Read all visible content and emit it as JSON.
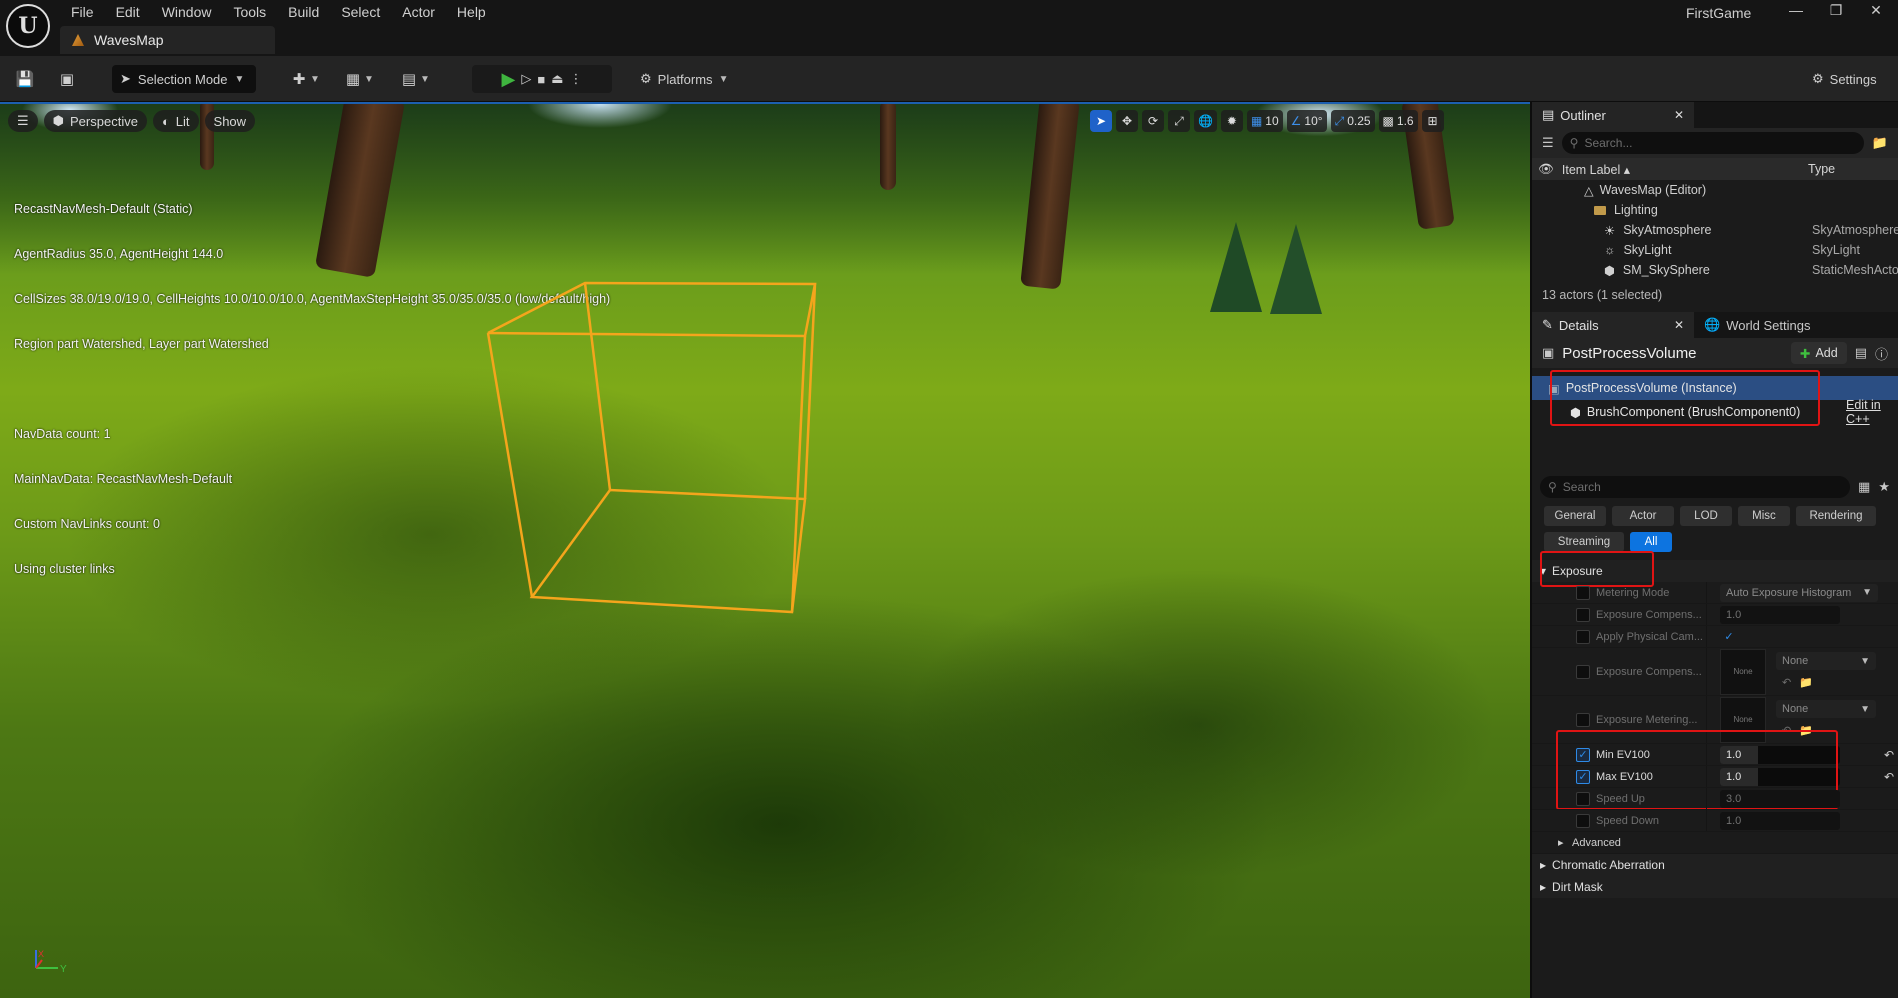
{
  "app": {
    "logo_text": "U",
    "menu": [
      "File",
      "Edit",
      "Window",
      "Tools",
      "Build",
      "Select",
      "Actor",
      "Help"
    ],
    "map_tab": "WavesMap",
    "project_name": "FirstGame",
    "win_minimize": "—",
    "win_restore": "❐",
    "win_close": "✕"
  },
  "toolbar": {
    "mode_label": "Selection Mode",
    "platforms_label": "Platforms",
    "settings_label": "Settings"
  },
  "viewport": {
    "perspective_label": "Perspective",
    "lit_label": "Lit",
    "show_label": "Show",
    "grid_snap": "10",
    "rotation_snap": "10°",
    "scale_snap": "0.25",
    "camera_speed": "1.6",
    "nav_info": [
      "RecastNavMesh-Default (Static)",
      "AgentRadius 35.0, AgentHeight 144.0",
      "CellSizes 38.0/19.0/19.0, CellHeights 10.0/10.0/10.0, AgentMaxStepHeight 35.0/35.0/35.0 (low/default/high)",
      "Region part Watershed, Layer part Watershed",
      "",
      "NavData count: 1",
      "MainNavData: RecastNavMesh-Default",
      "Custom NavLinks count: 0",
      "Using cluster links"
    ],
    "axis_x": "X",
    "axis_y": "Y",
    "axis_z": "Z"
  },
  "outliner": {
    "tab_label": "Outliner",
    "search_placeholder": "Search...",
    "col_label": "Item Label ▴",
    "col_type": "Type",
    "rows": [
      {
        "label": "WavesMap (Editor)",
        "type": ""
      },
      {
        "label": "Lighting",
        "type": ""
      },
      {
        "label": "SkyAtmosphere",
        "type": "SkyAtmosphere"
      },
      {
        "label": "SkyLight",
        "type": "SkyLight"
      },
      {
        "label": "SM_SkySphere",
        "type": "StaticMeshActor"
      }
    ],
    "actor_count": "13 actors (1 selected)"
  },
  "details": {
    "tab_label": "Details",
    "world_settings_label": "World Settings",
    "actor_name": "PostProcessVolume",
    "add_label": "Add",
    "component_root": "PostProcessVolume (Instance)",
    "component_child": "BrushComponent (BrushComponent0)",
    "edit_link": "Edit in C++",
    "search_placeholder": "Search",
    "filters_row1": [
      "General",
      "Actor",
      "LOD",
      "Misc",
      "Rendering"
    ],
    "filters_row2": [
      "Streaming",
      "All"
    ],
    "exposure_label": "Exposure",
    "metering_mode_label": "Metering Mode",
    "metering_mode_value": "Auto Exposure Histogram",
    "exposure_comp_label": "Exposure Compens...",
    "exposure_comp_value": "1.0",
    "apply_physical_label": "Apply Physical Cam...",
    "exposure_curve_label": "Exposure Compens...",
    "none_label": "None",
    "exposure_metering_label": "Exposure Metering...",
    "min_ev_label": "Min EV100",
    "min_ev_value": "1.0",
    "max_ev_label": "Max EV100",
    "max_ev_value": "1.0",
    "speed_up_label": "Speed Up",
    "speed_up_value": "3.0",
    "speed_down_label": "Speed Down",
    "speed_down_value": "1.0",
    "advanced_label": "Advanced",
    "chromatic_label": "Chromatic Aberration",
    "dirt_mask_label": "Dirt Mask"
  }
}
